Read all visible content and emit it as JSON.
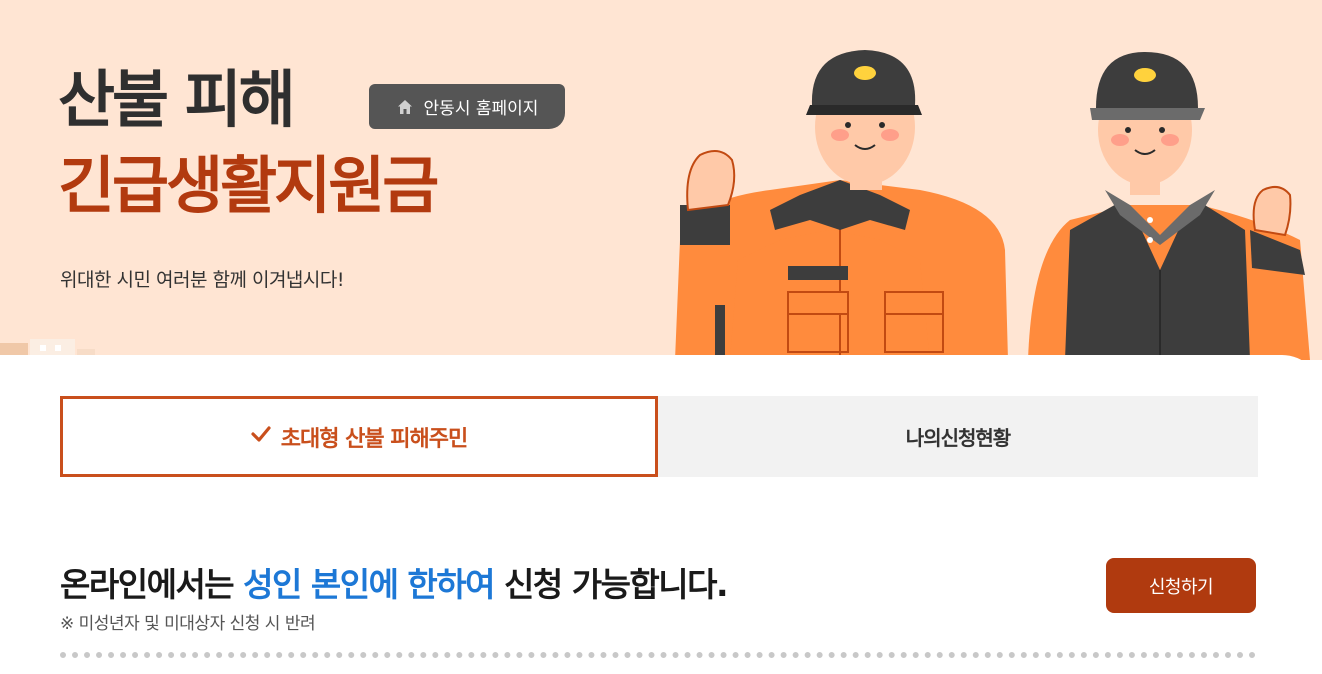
{
  "hero": {
    "title_line1": "산불 피해",
    "title_line2": "긴급생활지원금",
    "subtitle": "위대한 시민 여러분 함께 이겨냅시다!",
    "home_button_label": "안동시 홈페이지",
    "home_button_icon": "home-icon"
  },
  "tabs": [
    {
      "label": "초대형 산불 피해주민",
      "active": true,
      "icon": "check-icon"
    },
    {
      "label": "나의신청현황",
      "active": false
    }
  ],
  "notice": {
    "text_part1": "온라인에서는 ",
    "text_highlight": "성인 본인에 한하여",
    "text_part2": " 신청 가능합니다.",
    "subnote": "※ 미성년자 및 미대상자 신청 시 반려"
  },
  "apply_button_label": "신청하기",
  "colors": {
    "hero_bg": "#ffe5d3",
    "accent": "#b03a0f",
    "highlight_blue": "#1d78d6",
    "tab_active_border": "#c94f1c"
  }
}
